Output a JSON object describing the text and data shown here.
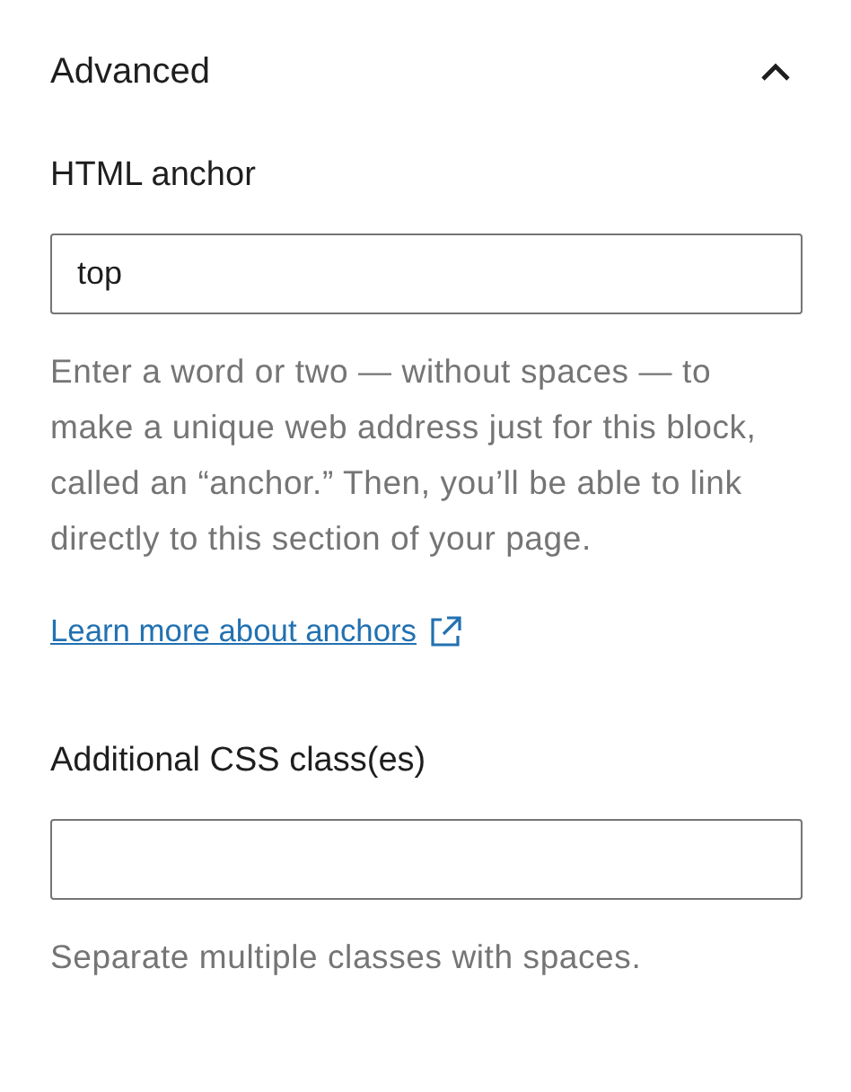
{
  "panel": {
    "title": "Advanced",
    "expanded": true
  },
  "fields": [
    {
      "label": "HTML anchor",
      "value": "top",
      "help": "Enter a word or two — without spaces — to make a unique web address just for this block, called an “anchor.” Then, you’ll be able to link directly to this section of your page.",
      "link": "Learn more about anchors"
    },
    {
      "label": "Additional CSS class(es)",
      "help": "Separate multiple classes with spaces."
    }
  ]
}
